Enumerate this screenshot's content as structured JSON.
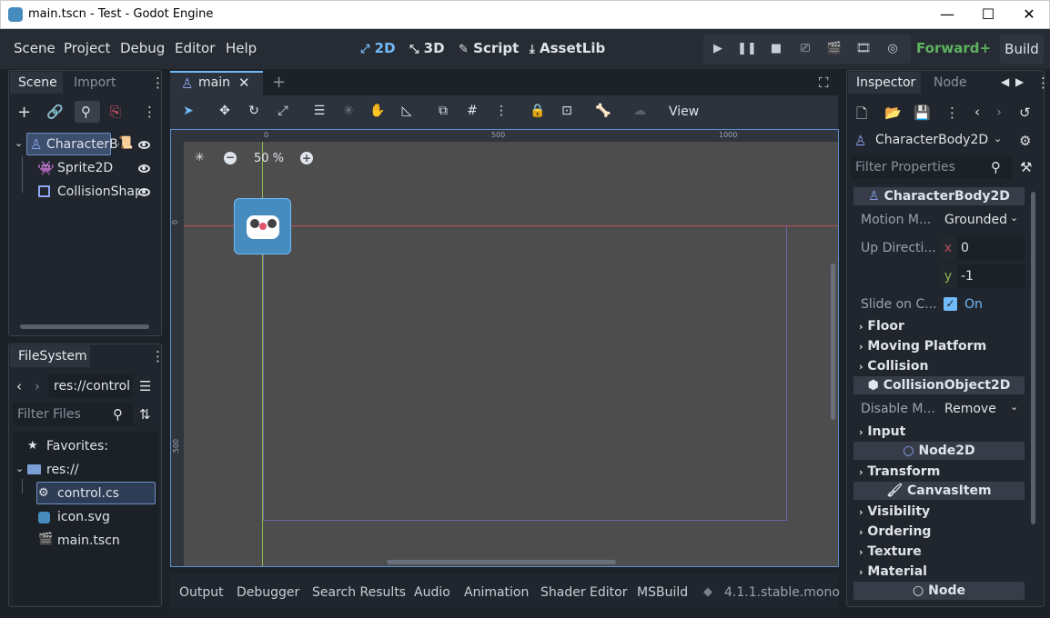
{
  "window": {
    "title": "main.tscn - Test - Godot Engine",
    "min_glyph": "—",
    "max_glyph": "☐",
    "close_glyph": "✕"
  },
  "menu": [
    "Scene",
    "Project",
    "Debug",
    "Editor",
    "Help"
  ],
  "workspaces": {
    "two_d": "2D",
    "three_d": "3D",
    "script": "Script",
    "assetlib": "AssetLib",
    "active": "2D"
  },
  "renderer": "Forward+",
  "build_label": "Build",
  "scene_dock": {
    "tabs": [
      "Scene",
      "Import"
    ],
    "tree": [
      {
        "label": "CharacterBo",
        "icon": "character-body-icon",
        "selected": true
      },
      {
        "label": "Sprite2D",
        "icon": "sprite-icon"
      },
      {
        "label": "CollisionShap",
        "icon": "collision-shape-icon"
      }
    ]
  },
  "filesystem": {
    "tab": "FileSystem",
    "path": "res://control",
    "filter_placeholder": "Filter Files",
    "items": [
      {
        "label": "Favorites:",
        "icon": "star-icon"
      },
      {
        "label": "res://",
        "icon": "folder-icon"
      },
      {
        "label": "control.cs",
        "icon": "csharp-file-icon",
        "selected": true
      },
      {
        "label": "icon.svg",
        "icon": "svg-file-icon"
      },
      {
        "label": "main.tscn",
        "icon": "scene-file-icon"
      }
    ]
  },
  "editor": {
    "tab_label": "main",
    "zoom": "50 %",
    "view_menu": "View",
    "ruler_labels": {
      "x0": "0",
      "x500": "500",
      "x1000": "1000",
      "y0": "0",
      "y500": "500"
    }
  },
  "bottom_panel": {
    "tabs": [
      "Output",
      "Debugger",
      "Search Results",
      "Audio",
      "Animation",
      "Shader Editor",
      "MSBuild"
    ],
    "version": "4.1.1.stable.mono"
  },
  "inspector": {
    "tabs": [
      "Inspector",
      "Node"
    ],
    "object_name": "CharacterBody2D",
    "filter_placeholder": "Filter Properties",
    "sections": {
      "character_body": "CharacterBody2D",
      "collision_object": "CollisionObject2D",
      "node2d": "Node2D",
      "canvas_item": "CanvasItem",
      "node": "Node"
    },
    "properties": {
      "motion_mode_label": "Motion M...",
      "motion_mode_value": "Grounded",
      "up_direction_label": "Up Directi...",
      "up_x_axis": "x",
      "up_x": "0",
      "up_y_axis": "y",
      "up_y": "-1",
      "slide_label": "Slide on C...",
      "slide_value": "On",
      "disable_mode_label": "Disable M...",
      "disable_mode_value": "Remove"
    },
    "categories": {
      "floor": "Floor",
      "moving_platform": "Moving Platform",
      "collision": "Collision",
      "input": "Input",
      "transform": "Transform",
      "visibility": "Visibility",
      "ordering": "Ordering",
      "texture": "Texture",
      "material": "Material"
    }
  },
  "colors": {
    "accent": "#70bafa",
    "renderer_green": "#5fb361",
    "x_axis": "#b84f5a",
    "y_axis": "#8fb550",
    "viewport_bg": "#4d4d4d"
  }
}
